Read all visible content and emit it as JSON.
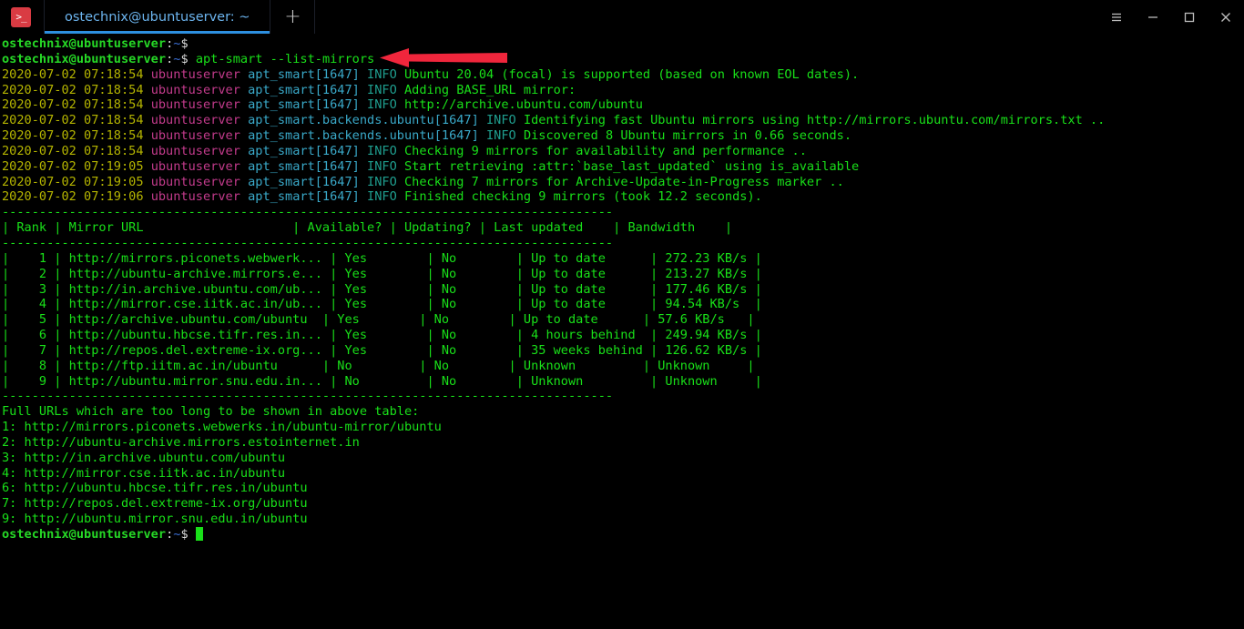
{
  "window": {
    "app_icon": "terminal-icon",
    "tab_title": "ostechnix@ubuntuserver: ~",
    "new_tab_label": "+",
    "controls": {
      "menu": "hamburger-menu-icon",
      "minimize": "minimize-icon",
      "maximize": "maximize-icon",
      "close": "close-icon"
    }
  },
  "terminal": {
    "prompt": {
      "user_host": "ostechnix@ubuntuserver",
      "colon": ":",
      "path": "~",
      "sigil": "$"
    },
    "command": "apt-smart --list-mirrors",
    "log_lines": [
      {
        "timestamp": "2020-07-02 07:18:54",
        "host": "ubuntuserver",
        "logger": "apt_smart[1647]",
        "level": "INFO",
        "message": "Ubuntu 20.04 (focal) is supported (based on known EOL dates)."
      },
      {
        "timestamp": "2020-07-02 07:18:54",
        "host": "ubuntuserver",
        "logger": "apt_smart[1647]",
        "level": "INFO",
        "message": "Adding BASE_URL mirror:"
      },
      {
        "timestamp": "2020-07-02 07:18:54",
        "host": "ubuntuserver",
        "logger": "apt_smart[1647]",
        "level": "INFO",
        "message": "http://archive.ubuntu.com/ubuntu"
      },
      {
        "timestamp": "2020-07-02 07:18:54",
        "host": "ubuntuserver",
        "logger": "apt_smart.backends.ubuntu[1647]",
        "level": "INFO",
        "message": "Identifying fast Ubuntu mirrors using http://mirrors.ubuntu.com/mirrors.txt .."
      },
      {
        "timestamp": "2020-07-02 07:18:54",
        "host": "ubuntuserver",
        "logger": "apt_smart.backends.ubuntu[1647]",
        "level": "INFO",
        "message": "Discovered 8 Ubuntu mirrors in 0.66 seconds."
      },
      {
        "timestamp": "2020-07-02 07:18:54",
        "host": "ubuntuserver",
        "logger": "apt_smart[1647]",
        "level": "INFO",
        "message": "Checking 9 mirrors for availability and performance .."
      },
      {
        "timestamp": "2020-07-02 07:19:05",
        "host": "ubuntuserver",
        "logger": "apt_smart[1647]",
        "level": "INFO",
        "message": "Start retrieving :attr:`base_last_updated` using is_available"
      },
      {
        "timestamp": "2020-07-02 07:19:05",
        "host": "ubuntuserver",
        "logger": "apt_smart[1647]",
        "level": "INFO",
        "message": "Checking 7 mirrors for Archive-Update-in-Progress marker .."
      },
      {
        "timestamp": "2020-07-02 07:19:06",
        "host": "ubuntuserver",
        "logger": "apt_smart[1647]",
        "level": "INFO",
        "message": "Finished checking 9 mirrors (took 12.2 seconds)."
      }
    ],
    "table": {
      "separator": "----------------------------------------------------------------------------------",
      "header": "| Rank | Mirror URL                    | Available? | Updating? | Last updated    | Bandwidth    |",
      "rows": [
        "|    1 | http://mirrors.piconets.webwerk... | Yes        | No        | Up to date      | 272.23 KB/s |",
        "|    2 | http://ubuntu-archive.mirrors.e... | Yes        | No        | Up to date      | 213.27 KB/s |",
        "|    3 | http://in.archive.ubuntu.com/ub... | Yes        | No        | Up to date      | 177.46 KB/s |",
        "|    4 | http://mirror.cse.iitk.ac.in/ub... | Yes        | No        | Up to date      | 94.54 KB/s  |",
        "|    5 | http://archive.ubuntu.com/ubuntu  | Yes        | No        | Up to date      | 57.6 KB/s   |",
        "|    6 | http://ubuntu.hbcse.tifr.res.in... | Yes        | No        | 4 hours behind  | 249.94 KB/s |",
        "|    7 | http://repos.del.extreme-ix.org... | Yes        | No        | 35 weeks behind | 126.62 KB/s |",
        "|    8 | http://ftp.iitm.ac.in/ubuntu      | No         | No        | Unknown         | Unknown     |",
        "|    9 | http://ubuntu.mirror.snu.edu.in... | No         | No        | Unknown         | Unknown     |"
      ]
    },
    "full_urls_heading": "Full URLs which are too long to be shown in above table:",
    "full_urls": [
      "1: http://mirrors.piconets.webwerks.in/ubuntu-mirror/ubuntu",
      "2: http://ubuntu-archive.mirrors.estointernet.in",
      "3: http://in.archive.ubuntu.com/ubuntu",
      "4: http://mirror.cse.iitk.ac.in/ubuntu",
      "6: http://ubuntu.hbcse.tifr.res.in/ubuntu",
      "7: http://repos.del.extreme-ix.org/ubuntu",
      "9: http://ubuntu.mirror.snu.edu.in/ubuntu"
    ]
  },
  "annotation": {
    "arrow_color": "#f0263c",
    "arrow_direction": "left"
  },
  "theme": {
    "background": "#000000",
    "green": "#19e019",
    "timestamp_color": "#b5b500",
    "host_color": "#c33b8c",
    "logger_color": "#3aa9c9",
    "level_color": "#1f9e8f",
    "tab_accent": "#2d8fe0"
  }
}
